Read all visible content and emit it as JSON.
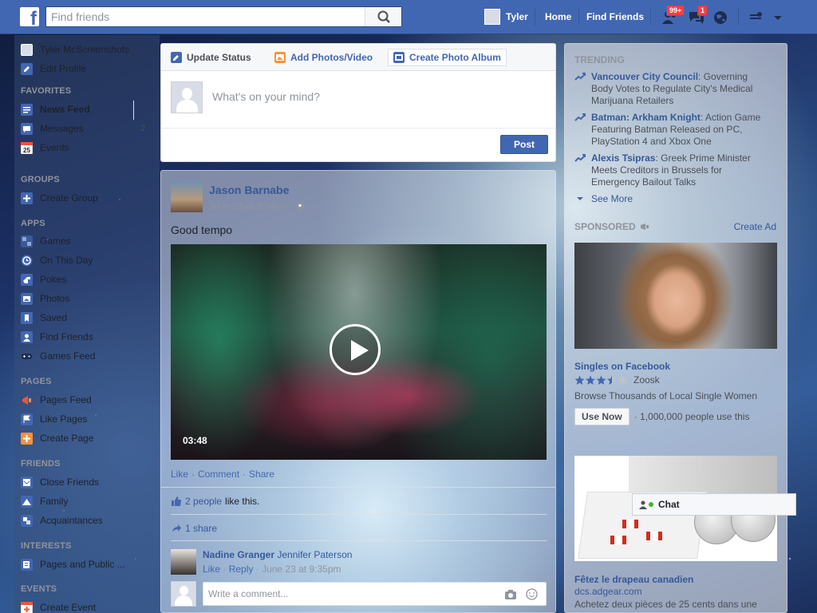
{
  "header": {
    "logo": "f",
    "search_placeholder": "Find friends",
    "user_name": "Tyler",
    "home": "Home",
    "find_friends": "Find Friends",
    "friend_requests_badge": "99+",
    "messages_badge": "1"
  },
  "leftnav": {
    "profile_name": "Tyler McScreenshots",
    "edit_profile": "Edit Profile",
    "favorites_head": "FAVORITES",
    "news_feed": "News Feed",
    "messages": "Messages",
    "messages_count": "2",
    "events": "Events",
    "events_day": "25",
    "groups_head": "GROUPS",
    "create_group": "Create Group",
    "apps_head": "APPS",
    "games": "Games",
    "on_this_day": "On This Day",
    "pokes": "Pokes",
    "photos": "Photos",
    "saved": "Saved",
    "find_friends": "Find Friends",
    "games_feed": "Games Feed",
    "pages_head": "PAGES",
    "pages_feed": "Pages Feed",
    "like_pages": "Like Pages",
    "create_page": "Create Page",
    "friends_head": "FRIENDS",
    "close_friends": "Close Friends",
    "family": "Family",
    "acquaintances": "Acquaintances",
    "interests_head": "INTERESTS",
    "pages_public": "Pages and Public ...",
    "events_head": "EVENTS",
    "create_event": "Create Event"
  },
  "composer": {
    "tab_status": "Update Status",
    "tab_photos": "Add Photos/Video",
    "tab_album": "Create Photo Album",
    "placeholder": "What's on your mind?",
    "post": "Post"
  },
  "story": {
    "author": "Jason Barnabe",
    "time": "June 23 at 9:34pm",
    "text": "Good tempo",
    "duration": "03:48",
    "like": "Like",
    "comment": "Comment",
    "share": "Share",
    "dot": "·",
    "likes_count": "2 people",
    "likes_suffix": "like this.",
    "shares": "1 share",
    "commenter": "Nadine Granger",
    "tagged": "Jennifer Paterson",
    "c_like": "Like",
    "c_reply": "Reply",
    "c_time": "June 23 at 9:35pm",
    "comment_placeholder": "Write a comment..."
  },
  "trending": {
    "head": "TRENDING",
    "items": [
      {
        "title": "Vancouver City Council",
        "desc": ": Governing Body Votes to Regulate City's Medical Marijuana Retailers"
      },
      {
        "title": "Batman: Arkham Knight",
        "desc": ": Action Game Featuring Batman Released on PC, PlayStation 4 and Xbox One"
      },
      {
        "title": "Alexis Tsipras",
        "desc": ": Greek Prime Minister Meets Creditors in Brussels for Emergency Bailout Talks"
      }
    ],
    "see_more": "See More"
  },
  "sponsored": {
    "head": "SPONSORED",
    "create_ad": "Create Ad",
    "ad1_title": "Singles on Facebook",
    "ad1_brand": "Zoosk",
    "ad1_rating": 3.5,
    "ad1_text": "Browse Thousands of Local Single Women",
    "ad1_button": "Use Now",
    "ad1_social": "· 1,000,000 people use this",
    "ad2_title": "Fêtez le drapeau canadien",
    "ad2_domain": "dcs.adgear.com",
    "ad2_text": "Achetez deux pièces de 25 cents dans une"
  },
  "chat": {
    "label": "Chat"
  },
  "colors": {
    "brand": "#4267b2",
    "link": "#365899",
    "badge": "#fa3e3e"
  }
}
